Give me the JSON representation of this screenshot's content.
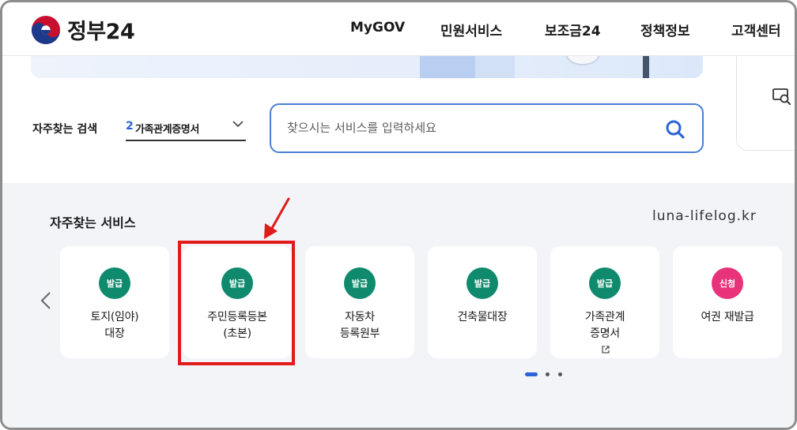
{
  "header": {
    "logo_text": "정부24",
    "nav": [
      "MyGOV",
      "민원서비스",
      "보조금24",
      "정책정보",
      "고객센터"
    ]
  },
  "search": {
    "frequent_label": "자주찾는 검색",
    "frequent_rank": "2",
    "frequent_term": "가족관계증명서",
    "placeholder": "찾으시는 서비스를 입력하세요"
  },
  "services": {
    "title": "자주찾는 서비스",
    "watermark": "luna-lifelog.kr",
    "items": [
      {
        "badge": "발급",
        "badge_color": "#0f8a6c",
        "line1": "토지(임야)",
        "line2": "대장"
      },
      {
        "badge": "발급",
        "badge_color": "#0f8a6c",
        "line1": "주민등록등본",
        "line2": "(초본)"
      },
      {
        "badge": "발급",
        "badge_color": "#0f8a6c",
        "line1": "자동차",
        "line2": "등록원부"
      },
      {
        "badge": "발급",
        "badge_color": "#0f8a6c",
        "line1": "건축물대장",
        "line2": ""
      },
      {
        "badge": "발급",
        "badge_color": "#0f8a6c",
        "line1": "가족관계",
        "line2": "증명서"
      },
      {
        "badge": "신청",
        "badge_color": "#e8337a",
        "line1": "여권 재발급",
        "line2": ""
      }
    ]
  },
  "colors": {
    "accent": "#2b63d9",
    "highlight": "#e01b1b"
  }
}
